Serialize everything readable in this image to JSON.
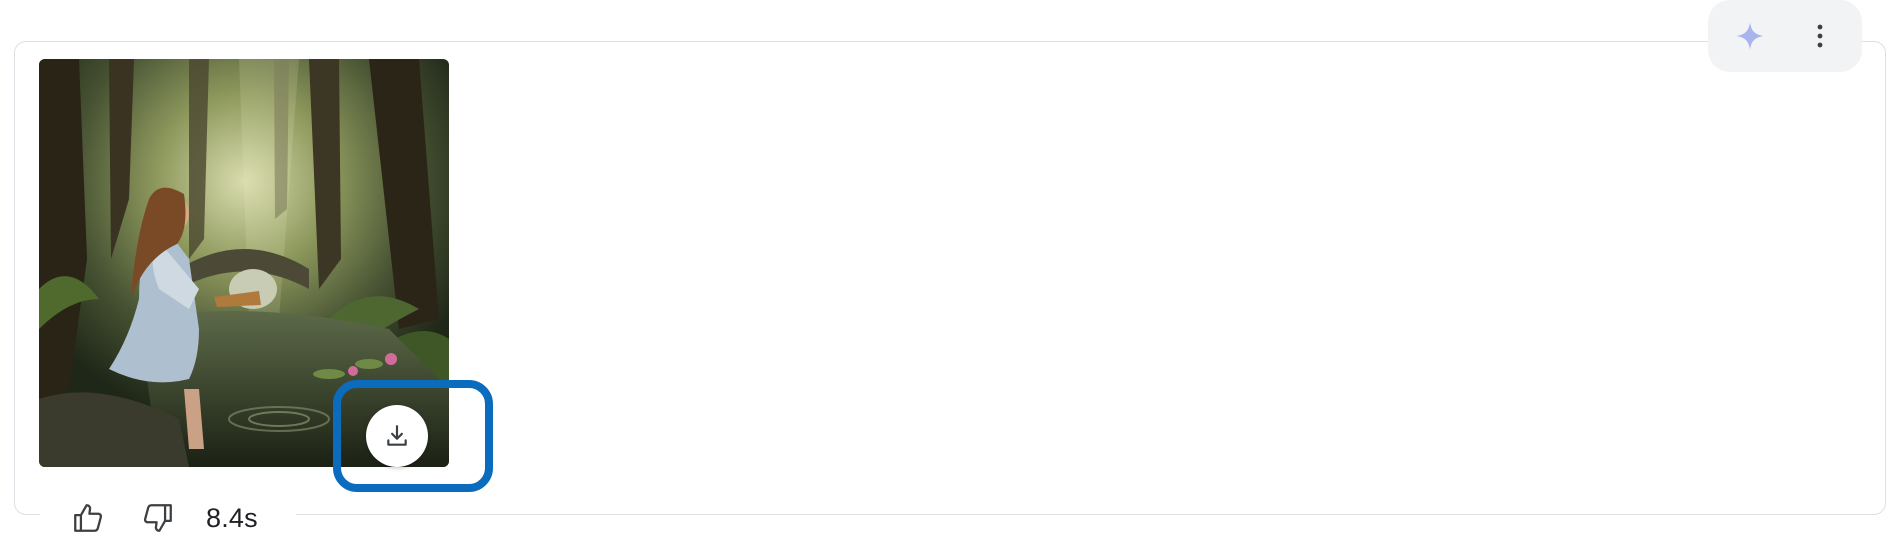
{
  "toolbar": {
    "items": [
      {
        "name": "sparkle",
        "icon": "sparkle-icon",
        "color": "#a8b4ee"
      },
      {
        "name": "more",
        "icon": "more-vert-icon",
        "color": "#3c4043"
      }
    ]
  },
  "result": {
    "image_icon": "generated-image",
    "download_icon": "download-icon",
    "highlight_color": "#0b6bbd"
  },
  "feedback": {
    "thumbs_up_icon": "thumbs-up-icon",
    "thumbs_down_icon": "thumbs-down-icon",
    "duration": "8.4s"
  }
}
